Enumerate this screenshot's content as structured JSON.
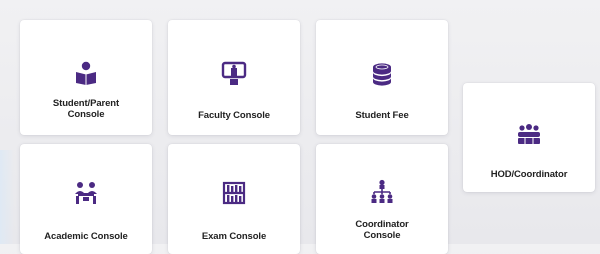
{
  "tiles": {
    "student_parent": {
      "label_line1": "Student/Parent",
      "label_line2": "Console",
      "icon": "student-reading-icon"
    },
    "faculty": {
      "label": "Faculty Console",
      "icon": "presentation-board-icon"
    },
    "student_fee": {
      "label": "Student Fee",
      "icon": "coin-stack-icon"
    },
    "hod": {
      "label": "HOD/Coordinator",
      "icon": "team-group-icon"
    },
    "academic": {
      "label": "Academic Console",
      "icon": "classroom-desk-icon"
    },
    "exam": {
      "label": "Exam Console",
      "icon": "exam-bookshelf-icon"
    },
    "coordinator": {
      "label_line1": "Coordinator",
      "label_line2": "Console",
      "icon": "org-hierarchy-icon"
    }
  },
  "colors": {
    "icon": "#4b2a83",
    "text": "#222222",
    "tile_bg": "#ffffff",
    "page_bg": "#eeeef1"
  }
}
